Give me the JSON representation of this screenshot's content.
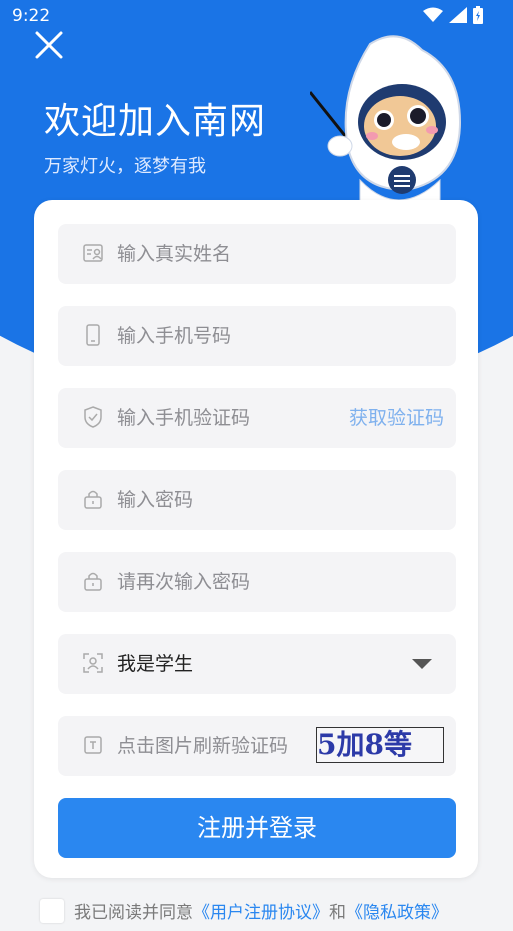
{
  "status_bar": {
    "time": "9:22"
  },
  "header": {
    "title": "欢迎加入南网",
    "subtitle": "万家灯火，逐梦有我"
  },
  "form": {
    "name_placeholder": "输入真实姓名",
    "phone_placeholder": "输入手机号码",
    "sms_placeholder": "输入手机验证码",
    "get_code_label": "获取验证码",
    "password_placeholder": "输入密码",
    "confirm_password_placeholder": "请再次输入密码",
    "identity_value": "我是学生",
    "captcha_placeholder": "点击图片刷新验证码",
    "captcha_text": "5加8等",
    "submit_label": "注册并登录"
  },
  "agreement": {
    "prefix": "我已阅读并同意",
    "user_agreement": "《用户注册协议》",
    "and": "和",
    "privacy_policy": "《隐私政策》"
  },
  "colors": {
    "brand": "#1a74e6",
    "button": "#2a87f0",
    "link": "#2a87f0"
  }
}
